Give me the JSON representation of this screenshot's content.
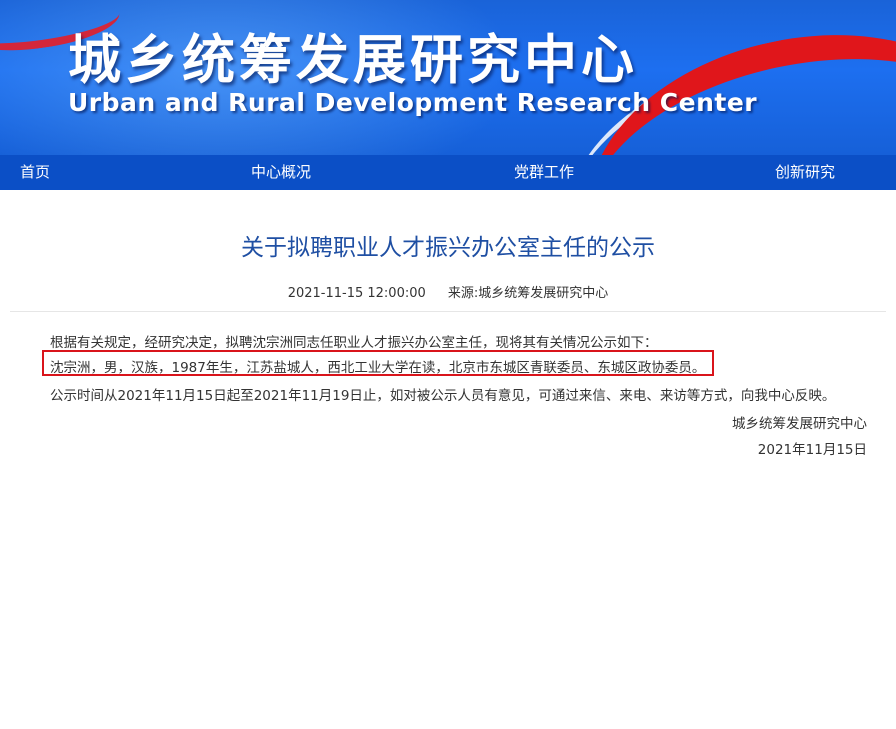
{
  "header": {
    "title_cn": "城乡统筹发展研究中心",
    "title_en": "Urban and Rural Development Research Center"
  },
  "nav": {
    "items": [
      {
        "label": "首页"
      },
      {
        "label": "中心概况"
      },
      {
        "label": "党群工作"
      },
      {
        "label": "创新研究"
      }
    ]
  },
  "article": {
    "title": "关于拟聘职业人才振兴办公室主任的公示",
    "date": "2021-11-15 12:00:00",
    "source": "来源:城乡统筹发展研究中心",
    "paragraphs": [
      "根据有关规定，经研究决定，拟聘沈宗洲同志任职业人才振兴办公室主任，现将其有关情况公示如下：",
      "沈宗洲，男，汉族，1987年生，江苏盐城人，西北工业大学在读，北京市东城区青联委员、东城区政协委员。",
      "公示时间从2021年11月15日起至2021年11月19日止，如对被公示人员有意见，可通过来信、来电、来访等方式，向我中心反映。"
    ],
    "signature": "城乡统筹发展研究中心",
    "sign_date": "2021年11月15日"
  },
  "colors": {
    "banner_blue": "#1d6ff0",
    "nav_blue": "#0b4fc6",
    "title_blue": "#1f4fa3",
    "highlight_red": "#d9141b"
  }
}
